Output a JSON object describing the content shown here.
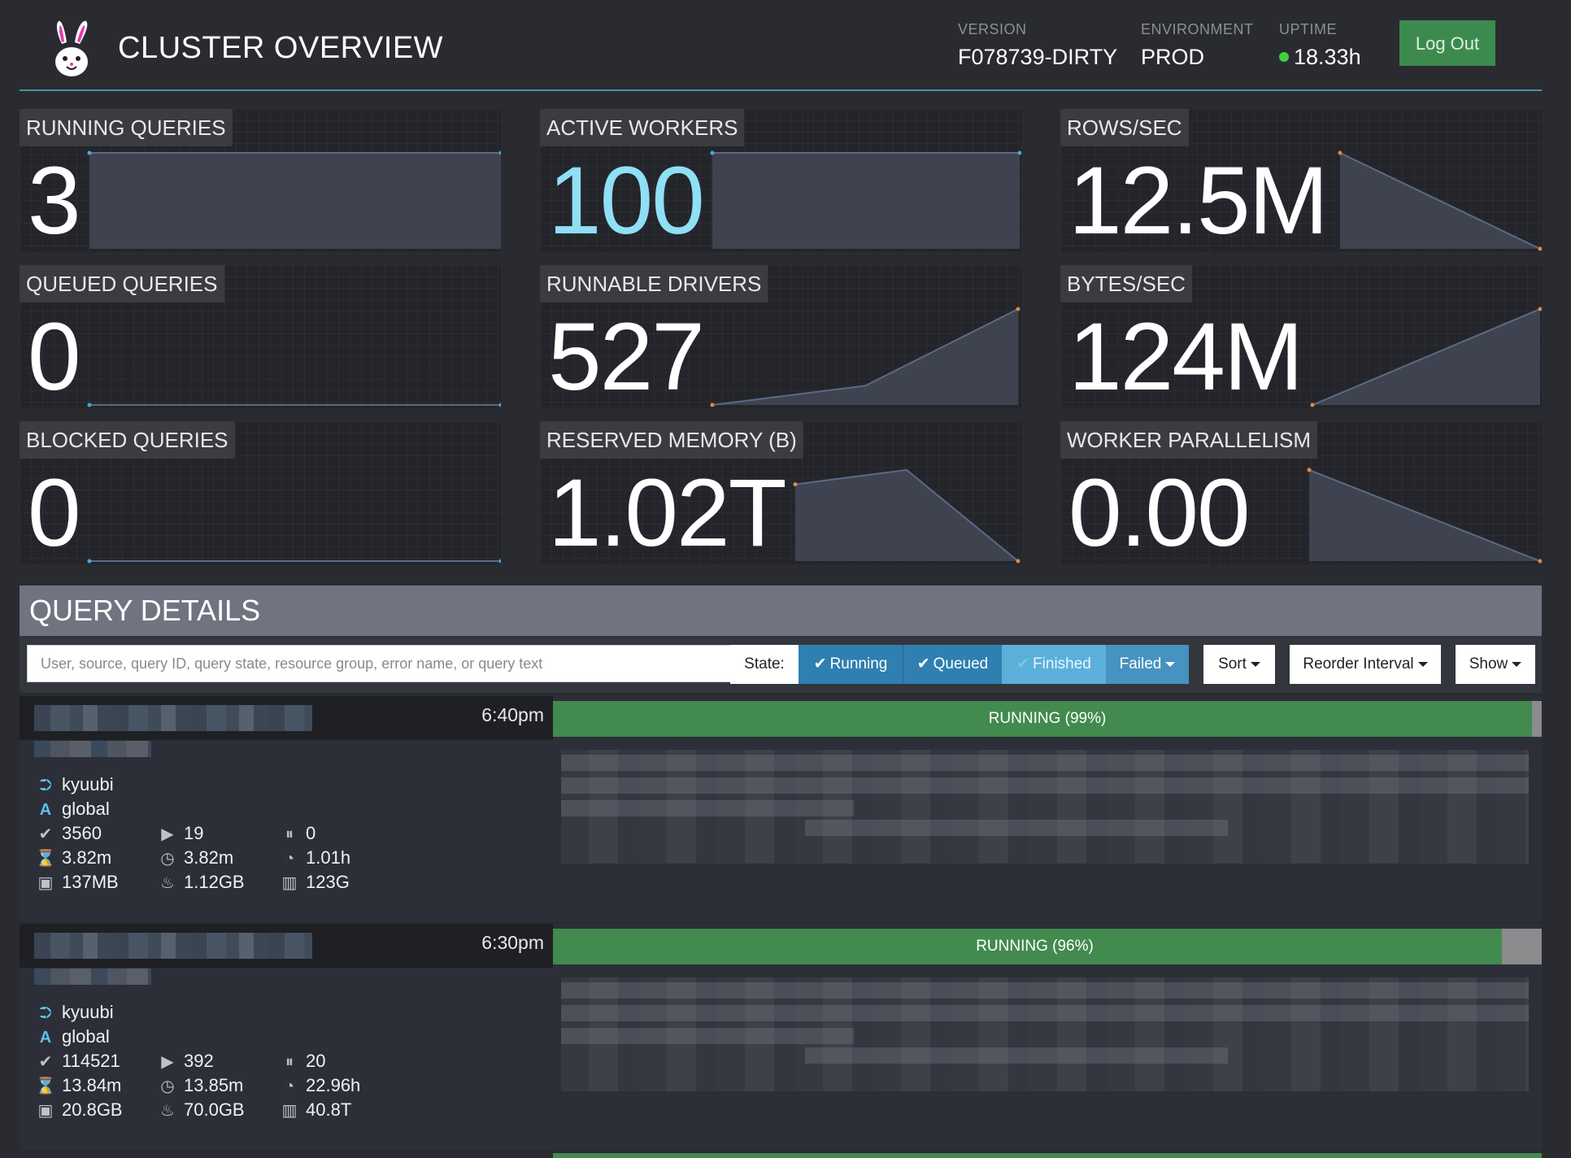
{
  "header": {
    "title": "CLUSTER OVERVIEW",
    "version_label": "VERSION",
    "version_value": "F078739-DIRTY",
    "environment_label": "ENVIRONMENT",
    "environment_value": "PROD",
    "uptime_label": "UPTIME",
    "uptime_value": "18.33h",
    "logout_label": "Log Out"
  },
  "tiles": [
    {
      "label": "RUNNING QUERIES",
      "value": "3",
      "spark": [
        1,
        1
      ]
    },
    {
      "label": "ACTIVE WORKERS",
      "value": "100",
      "spark": [
        1,
        1
      ]
    },
    {
      "label": "ROWS/SEC",
      "value": "12.5M",
      "spark": [
        1,
        0
      ]
    },
    {
      "label": "QUEUED QUERIES",
      "value": "0",
      "spark": [
        0,
        0
      ]
    },
    {
      "label": "RUNNABLE DRIVERS",
      "value": "527",
      "spark": [
        0,
        0.2,
        1
      ]
    },
    {
      "label": "BYTES/SEC",
      "value": "124M",
      "spark": [
        0,
        1
      ]
    },
    {
      "label": "BLOCKED QUERIES",
      "value": "0",
      "spark": [
        0,
        0
      ]
    },
    {
      "label": "RESERVED MEMORY (B)",
      "value": "1.02T",
      "spark": [
        0.8,
        0.95,
        0
      ]
    },
    {
      "label": "WORKER PARALLELISM",
      "value": "0.00",
      "spark": [
        0.95,
        0
      ]
    }
  ],
  "query_details": {
    "title": "QUERY DETAILS",
    "search_placeholder": "User, source, query ID, query state, resource group, error name, or query text",
    "state_label": "State:",
    "state_buttons": [
      "Running",
      "Queued",
      "Finished",
      "Failed"
    ],
    "sort_label": "Sort",
    "reorder_label": "Reorder Interval",
    "show_label": "Show"
  },
  "queries": [
    {
      "time": "6:40pm",
      "state_text": "RUNNING (99%)",
      "progress": 0.99,
      "user": "kyuubi",
      "resource_group": "global",
      "completed_splits": "3560",
      "running_splits": "19",
      "queued_splits": "0",
      "wall_time": "3.82m",
      "elapsed_time": "3.82m",
      "cpu_time": "1.01h",
      "current_memory": "137MB",
      "peak_memory": "1.12GB",
      "input_bytes": "123G"
    },
    {
      "time": "6:30pm",
      "state_text": "RUNNING (96%)",
      "progress": 0.96,
      "user": "kyuubi",
      "resource_group": "global",
      "completed_splits": "114521",
      "running_splits": "392",
      "queued_splits": "20",
      "wall_time": "13.84m",
      "elapsed_time": "13.85m",
      "cpu_time": "22.96h",
      "current_memory": "20.8GB",
      "peak_memory": "70.0GB",
      "input_bytes": "40.8T"
    }
  ]
}
